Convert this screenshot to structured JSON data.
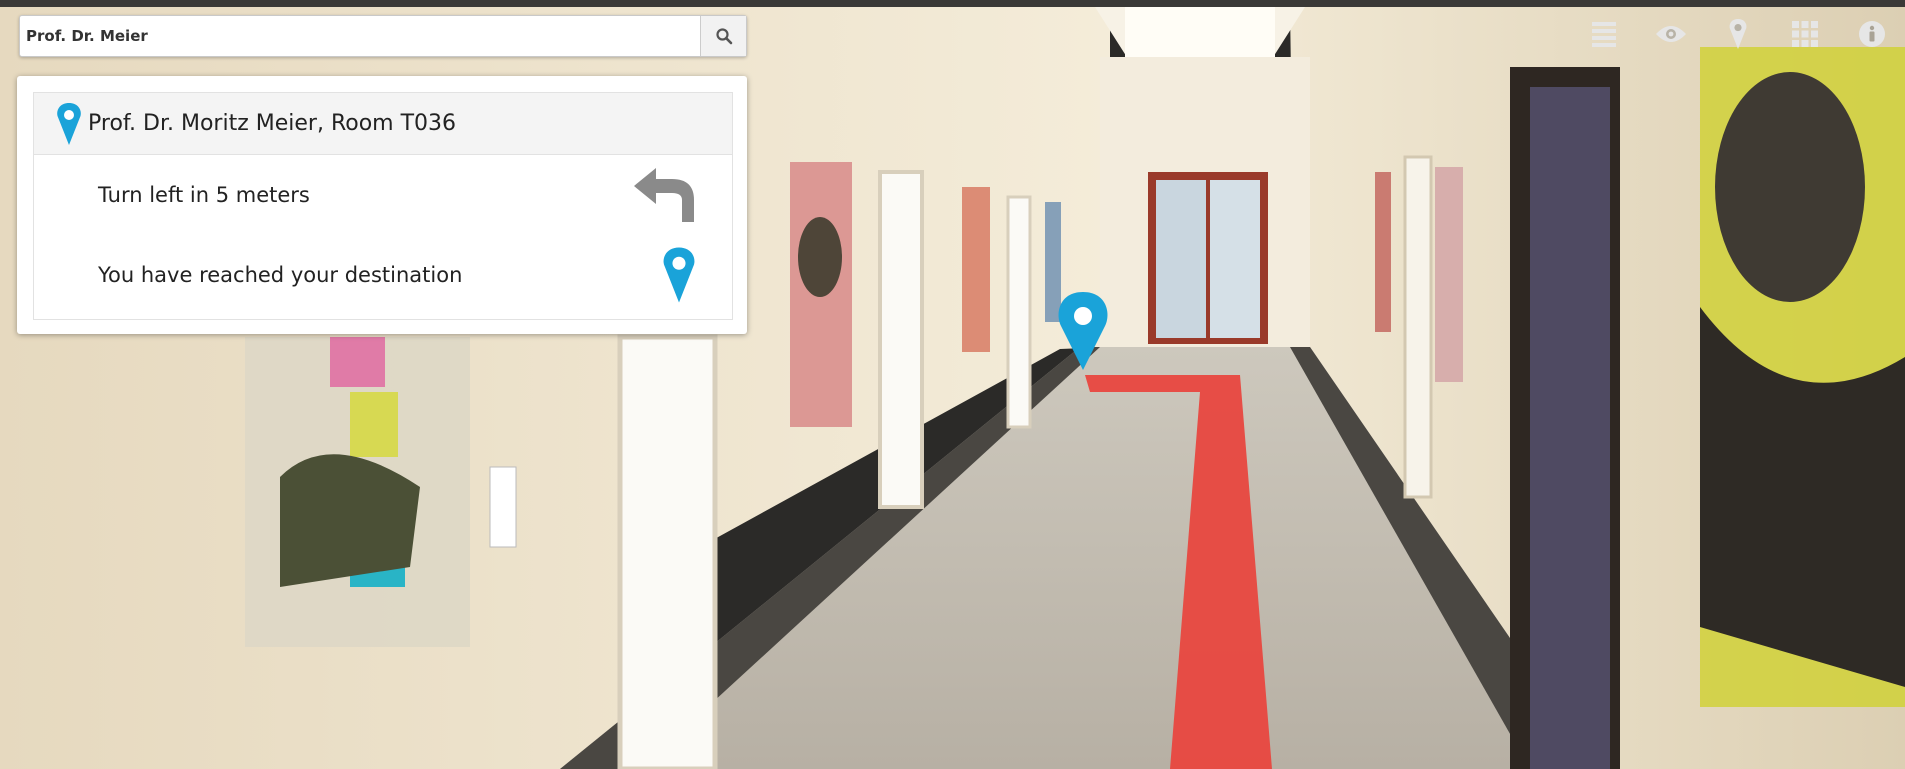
{
  "search": {
    "value": "Prof. Dr. Meier"
  },
  "route": {
    "destination": "Prof. Dr. Moritz Meier, Room T036",
    "steps": [
      {
        "text": "Turn left in 5 meters",
        "icon": "turn-left-arrow-icon"
      },
      {
        "text": "You have reached your destination",
        "icon": "map-pin-icon"
      }
    ]
  },
  "toolbar": {
    "icons": [
      "list-icon",
      "eye-icon",
      "map-pin-icon",
      "grid-icon",
      "info-icon"
    ]
  },
  "colors": {
    "accent": "#1aa3d9",
    "route": "#e8473f",
    "toolbar_icon": "#e6e6e6"
  }
}
